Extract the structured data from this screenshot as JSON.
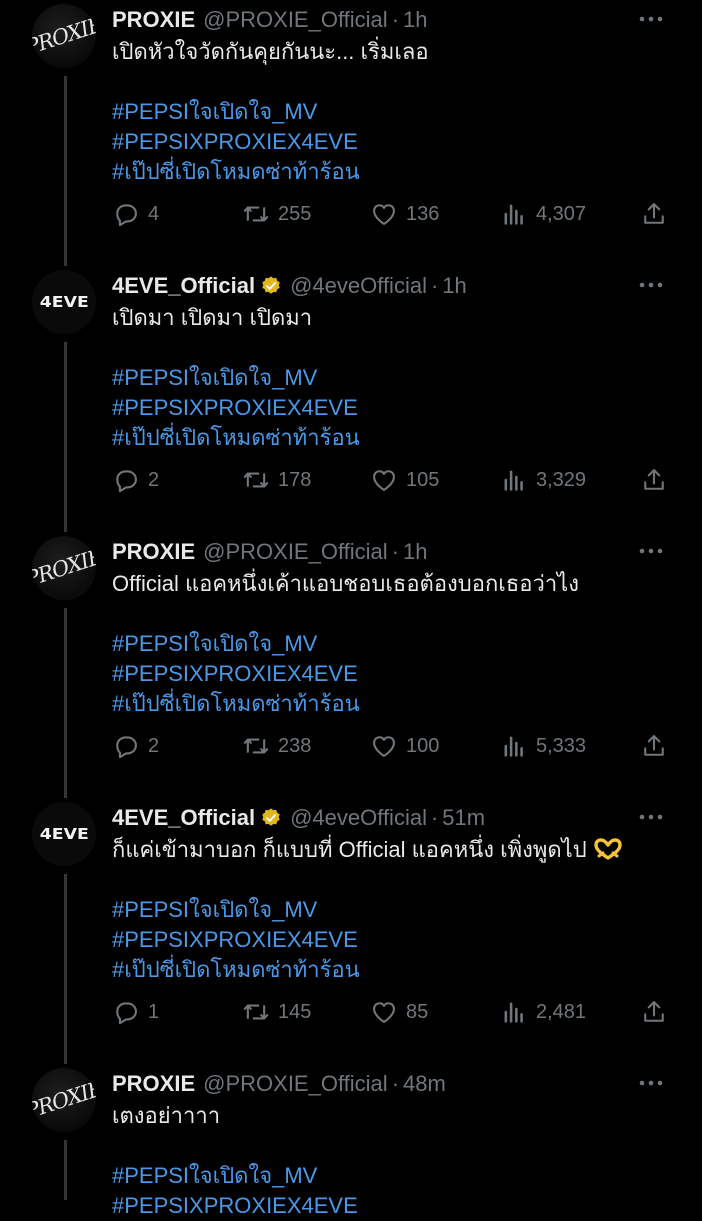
{
  "colors": {
    "background": "#000000",
    "text": "#e7e9ea",
    "muted": "#71767b",
    "hashtag": "#4a99e9",
    "verified": "#e2b719"
  },
  "tweets": [
    {
      "avatar": "PROXIE",
      "name": "PROXIE",
      "handle": "@PROXIE_Official",
      "time": "1h",
      "text": "เปิดหัวใจวัดกันคุยกันนะ... เริ่มเลอ",
      "hashtags": [
        "#PEPSIใจเปิดใจ_MV",
        "#PEPSIXPROXIEX4EVE",
        "#เป๊ปซี่เปิดโหมดซ่าท้าร้อน"
      ],
      "replies": "4",
      "retweets": "255",
      "likes": "136",
      "views": "4,307"
    },
    {
      "avatar": "4EVE",
      "name": "4EVE_Official",
      "handle": "@4eveOfficial",
      "time": "1h",
      "text": "เปิดมา เปิดมา เปิดมา",
      "hashtags": [
        "#PEPSIใจเปิดใจ_MV",
        "#PEPSIXPROXIEX4EVE",
        "#เป๊ปซี่เปิดโหมดซ่าท้าร้อน"
      ],
      "replies": "2",
      "retweets": "178",
      "likes": "105",
      "views": "3,329"
    },
    {
      "avatar": "PROXIE",
      "name": "PROXIE",
      "handle": "@PROXIE_Official",
      "time": "1h",
      "text": "Official แอคหนึ่งเค้าแอบชอบเธอต้องบอกเธอว่าไง",
      "hashtags": [
        "#PEPSIใจเปิดใจ_MV",
        "#PEPSIXPROXIEX4EVE",
        "#เป๊ปซี่เปิดโหมดซ่าท้าร้อน"
      ],
      "replies": "2",
      "retweets": "238",
      "likes": "100",
      "views": "5,333"
    },
    {
      "avatar": "4EVE",
      "name": "4EVE_Official",
      "handle": "@4eveOfficial",
      "time": "51m",
      "text": "ก็แค่เข้ามาบอก ก็แบบที่ Official แอคหนึ่ง เพิ่งพูดไป",
      "hashtags": [
        "#PEPSIใจเปิดใจ_MV",
        "#PEPSIXPROXIEX4EVE",
        "#เป๊ปซี่เปิดโหมดซ่าท้าร้อน"
      ],
      "replies": "1",
      "retweets": "145",
      "likes": "85",
      "views": "2,481"
    },
    {
      "avatar": "PROXIE",
      "name": "PROXIE",
      "handle": "@PROXIE_Official",
      "time": "48m",
      "text": "เตงอย่าาาา",
      "hashtags": [
        "#PEPSIใจเปิดใจ_MV",
        "#PEPSIXPROXIEX4EVE"
      ],
      "replies": "",
      "retweets": "",
      "likes": "",
      "views": ""
    }
  ]
}
